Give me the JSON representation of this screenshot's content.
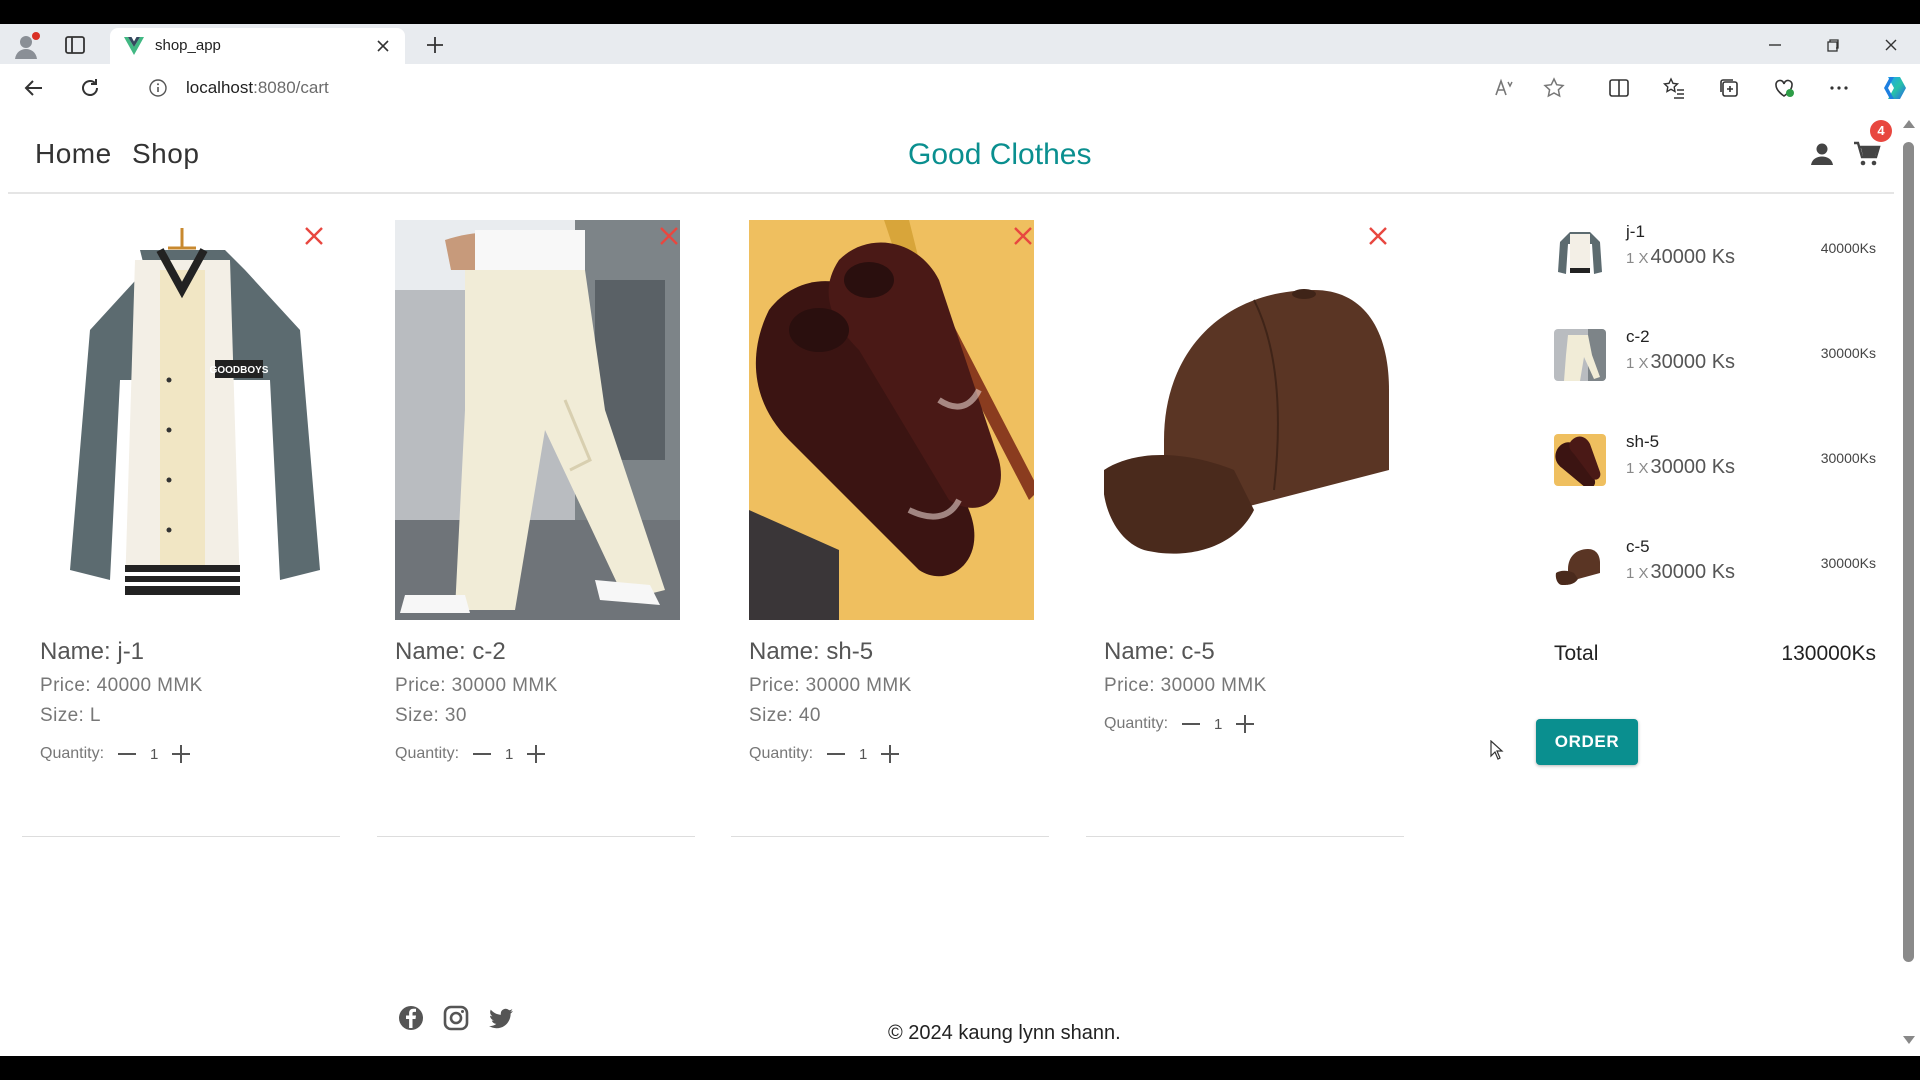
{
  "browser": {
    "tab_title": "shop_app",
    "url_host": "localhost",
    "url_path": ":8080/cart"
  },
  "nav": {
    "home": "Home",
    "shop": "Shop",
    "brand": "Good Clothes",
    "cart_count": "4"
  },
  "cart_items": [
    {
      "name": "Name: j-1",
      "price": "Price: 40000 MMK",
      "size": "Size: L",
      "quantity_label": "Quantity:",
      "quantity": "1",
      "image": "jacket"
    },
    {
      "name": "Name: c-2",
      "price": "Price: 30000 MMK",
      "size": "Size: 30",
      "quantity_label": "Quantity:",
      "quantity": "1",
      "image": "pants"
    },
    {
      "name": "Name: sh-5",
      "price": "Price: 30000 MMK",
      "size": "Size: 40",
      "quantity_label": "Quantity:",
      "quantity": "1",
      "image": "shoes"
    },
    {
      "name": "Name: c-5",
      "price": "Price: 30000 MMK",
      "quantity_label": "Quantity:",
      "quantity": "1",
      "image": "cap"
    }
  ],
  "summary": {
    "items": [
      {
        "code": "j-1",
        "qty": "1",
        "x": "X",
        "unit": "40000 Ks",
        "line_total": "40000Ks"
      },
      {
        "code": "c-2",
        "qty": "1",
        "x": "X",
        "unit": "30000 Ks",
        "line_total": "30000Ks"
      },
      {
        "code": "sh-5",
        "qty": "1",
        "x": "X",
        "unit": "30000 Ks",
        "line_total": "30000Ks"
      },
      {
        "code": "c-5",
        "qty": "1",
        "x": "X",
        "unit": "30000 Ks",
        "line_total": "30000Ks"
      }
    ],
    "total_label": "Total",
    "total_value": "130000Ks",
    "order_label": "ORDER"
  },
  "footer": {
    "copyright": "© 2024 kaung lynn shann."
  },
  "colors": {
    "brand": "#0a8f8f",
    "badge": "#e8473f",
    "remove": "#e8473f"
  },
  "icons": [
    "facebook-icon",
    "instagram-icon",
    "twitter-icon",
    "user-icon",
    "cart-icon"
  ]
}
